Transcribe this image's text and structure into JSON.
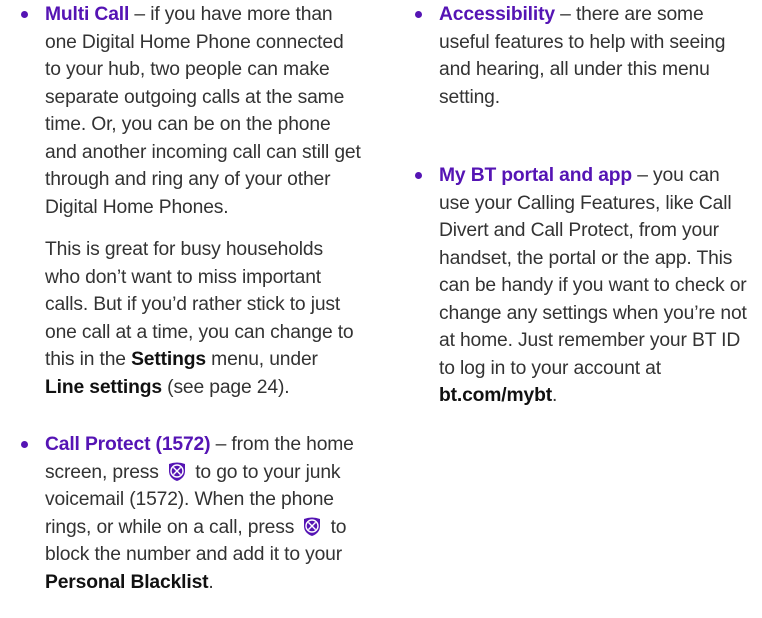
{
  "left_column": {
    "multi_call": {
      "term": "Multi Call",
      "dash": " – ",
      "text": "if you have more than one Digital Home Phone connected to your hub, two people can make separate outgoing calls at the same time. Or, you can be on the phone and another incoming call can still get through and ring any of your other Digital Home Phones.",
      "para2_a": "This is great for busy households who don’t want to miss important calls. But if you’d rather stick to just one call at a time, you can change to this in the ",
      "settings": "Settings",
      "para2_b": " menu, under ",
      "line_settings": "Line settings",
      "para2_c": " (see page 24)."
    },
    "call_protect": {
      "term": "Call Protect (1572)",
      "dash": " – ",
      "text_a": "from the home screen, press ",
      "text_b": " to go to your junk voicemail (1572). When the phone rings, or while on a call, press ",
      "text_c": " to block the number and add it to your ",
      "blacklist": "Personal Blacklist",
      "text_d": ".",
      "icon": "block-call-icon"
    }
  },
  "right_column": {
    "accessibility": {
      "term": "Accessibility",
      "dash": " – ",
      "text": "there are some useful features to help with seeing and hearing, all under this menu setting."
    },
    "portal": {
      "term": "My BT portal and app",
      "dash": " – ",
      "text_a": "you can use your Calling Features, like Call Divert and Call Protect, from your handset, the portal or the app. This can be handy if you want to check or change any settings when you’re not at home. Just remember your BT ID to log in to your account at ",
      "link": "bt.com/mybt",
      "text_b": "."
    }
  },
  "colors": {
    "accent": "#5514b4",
    "text": "#333333"
  }
}
